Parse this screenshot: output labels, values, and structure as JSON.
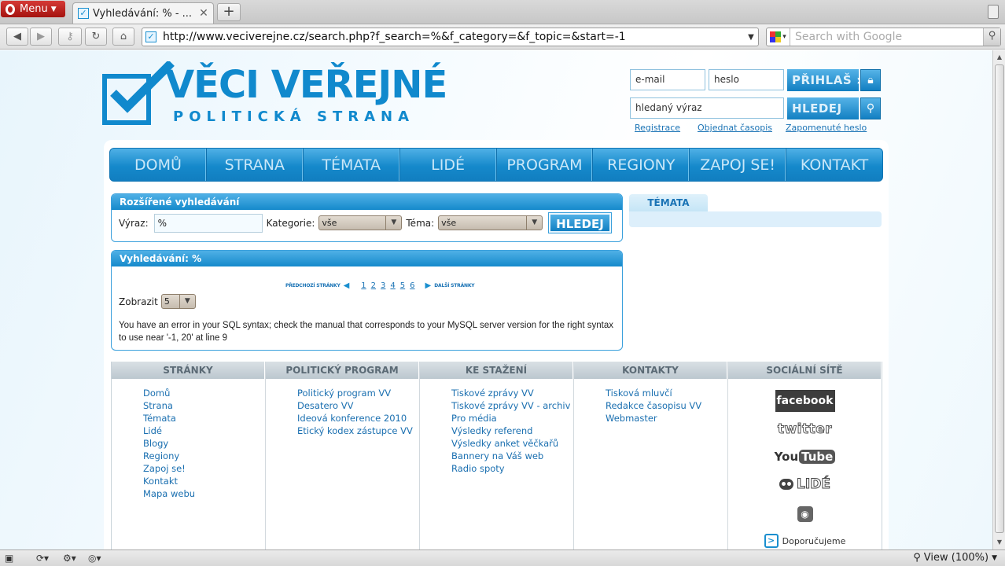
{
  "browser": {
    "menu_label": "Menu",
    "tab_title": "Vyhledávání: % - ...",
    "new_tab": "+",
    "url": "http://www.veciverejne.cz/search.php?f_search=%&f_category=&f_topic=&start=-1",
    "search_placeholder": "Search with Google",
    "zoom_label": "View (100%)"
  },
  "header": {
    "logo_title": "VĚCI VEŘEJNÉ",
    "logo_subtitle": "POLITICKÁ STRANA",
    "email_placeholder": "e-mail",
    "password_placeholder": "heslo",
    "login_button": "PŘIHLAŠ",
    "search_placeholder": "hledaný výraz",
    "search_button": "HLEDEJ",
    "links": [
      "Registrace",
      "Objednat časopis",
      "Zapomenuté heslo"
    ]
  },
  "nav": [
    "DOMŮ",
    "STRANA",
    "TÉMATA",
    "LIDÉ",
    "PROGRAM",
    "REGIONY",
    "ZAPOJ SE!",
    "KONTAKT"
  ],
  "advanced_search": {
    "title": "Rozšířené vyhledávání",
    "vyraz_label": "Výraz:",
    "vyraz_value": "%",
    "kategorie_label": "Kategorie:",
    "kategorie_value": "vše",
    "tema_label": "Téma:",
    "tema_value": "vše",
    "button": "HLEDEJ"
  },
  "results": {
    "title": "Vyhledávání: %",
    "prev_label": "PŘEDCHOZÍ STRÁNKY",
    "next_label": "DALŠÍ STRÁNKY",
    "pages": [
      "1",
      "2",
      "3",
      "4",
      "5",
      "6"
    ],
    "zobrazit_label": "Zobrazit",
    "zobrazit_value": "5",
    "error_text": "You have an error in your SQL syntax; check the manual that corresponds to your MySQL server version for the right syntax to use near '-1, 20' at line 9"
  },
  "sidebar": {
    "tab_label": "TÉMATA"
  },
  "footer": {
    "columns": [
      {
        "heading": "STRÁNKY",
        "items": [
          "Domů",
          "Strana",
          "Témata",
          "Lidé",
          "Blogy",
          "Regiony",
          "Zapoj se!",
          "Kontakt",
          "Mapa webu"
        ]
      },
      {
        "heading": "POLITICKÝ PROGRAM",
        "items": [
          "Politický program VV",
          "Desatero VV",
          "Ideová konference 2010",
          "Etický kodex zástupce VV"
        ]
      },
      {
        "heading": "KE STAŽENÍ",
        "items": [
          "Tiskové zprávy VV",
          "Tiskové zprávy VV - archiv",
          "Pro média",
          "Výsledky referend",
          "Výsledky anket věčkařů",
          "Bannery na Váš web",
          "Radio spoty"
        ]
      },
      {
        "heading": "KONTAKTY",
        "items": [
          "Tisková mluvčí",
          "Redakce časopisu VV",
          "Webmaster"
        ]
      }
    ],
    "social_heading": "SOCIÁLNÍ SÍTĚ",
    "social": {
      "facebook": "facebook",
      "twitter": "twitter",
      "youtube_you": "You",
      "youtube_tube": "Tube",
      "lide": "LIDÉ",
      "doporucujeme": "Doporučujeme"
    }
  }
}
